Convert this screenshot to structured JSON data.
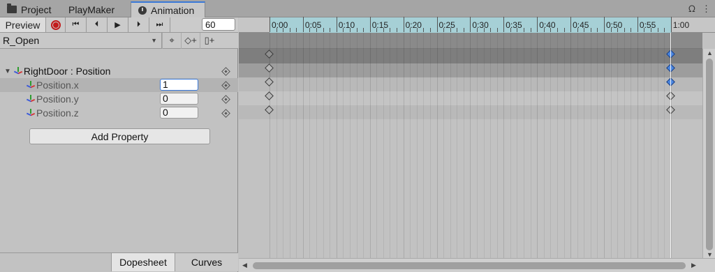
{
  "tabs": [
    {
      "label": "Project",
      "icon": "folder-icon"
    },
    {
      "label": "PlayMaker",
      "icon": ""
    },
    {
      "label": "Animation",
      "icon": "clock-icon"
    }
  ],
  "window_controls": {
    "lock": "🔒",
    "menu": "⋮"
  },
  "toolbar": {
    "preview_label": "Preview",
    "first_key": "⏮",
    "prev_key": "⏴",
    "play": "▶",
    "next_key": "⏵",
    "last_key": "⏭",
    "frame_value": "60"
  },
  "clip": {
    "name": "R_Open",
    "dropdown_arrow": "▼"
  },
  "properties": {
    "group_label": "RightDoor : Position",
    "items": [
      {
        "label": "Position.x",
        "value": "1"
      },
      {
        "label": "Position.y",
        "value": "0"
      },
      {
        "label": "Position.z",
        "value": "0"
      }
    ]
  },
  "add_property_label": "Add Property",
  "bottom_tabs": {
    "dopesheet": "Dopesheet",
    "curves": "Curves"
  },
  "timeline": {
    "labels": [
      "0:00",
      "0:05",
      "0:10",
      "0:15",
      "0:20",
      "0:25",
      "0:30",
      "0:35",
      "0:40",
      "0:45",
      "0:50",
      "0:55",
      "1:00"
    ]
  },
  "colors": {
    "accent": "#3a79d8",
    "record": "#c21b1b",
    "ruler_active": "#a6d0d6",
    "key_selected": "#4a86e0"
  }
}
